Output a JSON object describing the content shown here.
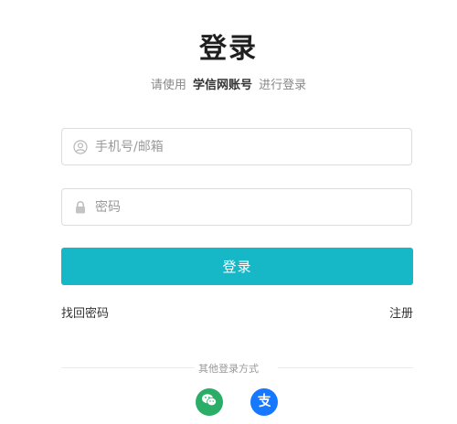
{
  "header": {
    "title": "登录",
    "subtitle_prefix": "请使用",
    "subtitle_brand": "学信网账号",
    "subtitle_suffix": "进行登录"
  },
  "form": {
    "username_placeholder": "手机号/邮箱",
    "username_value": "",
    "password_placeholder": "密码",
    "password_value": "",
    "login_label": "登录"
  },
  "links": {
    "forgot_password": "找回密码",
    "register": "注册"
  },
  "other_login": {
    "label": "其他登录方式",
    "methods": [
      {
        "icon": "wechat-icon",
        "color": "#2aae67"
      },
      {
        "icon": "alipay-icon",
        "color": "#1677ff"
      }
    ]
  },
  "colors": {
    "accent": "#16b8c8",
    "wechat": "#2aae67",
    "alipay": "#1677ff"
  }
}
